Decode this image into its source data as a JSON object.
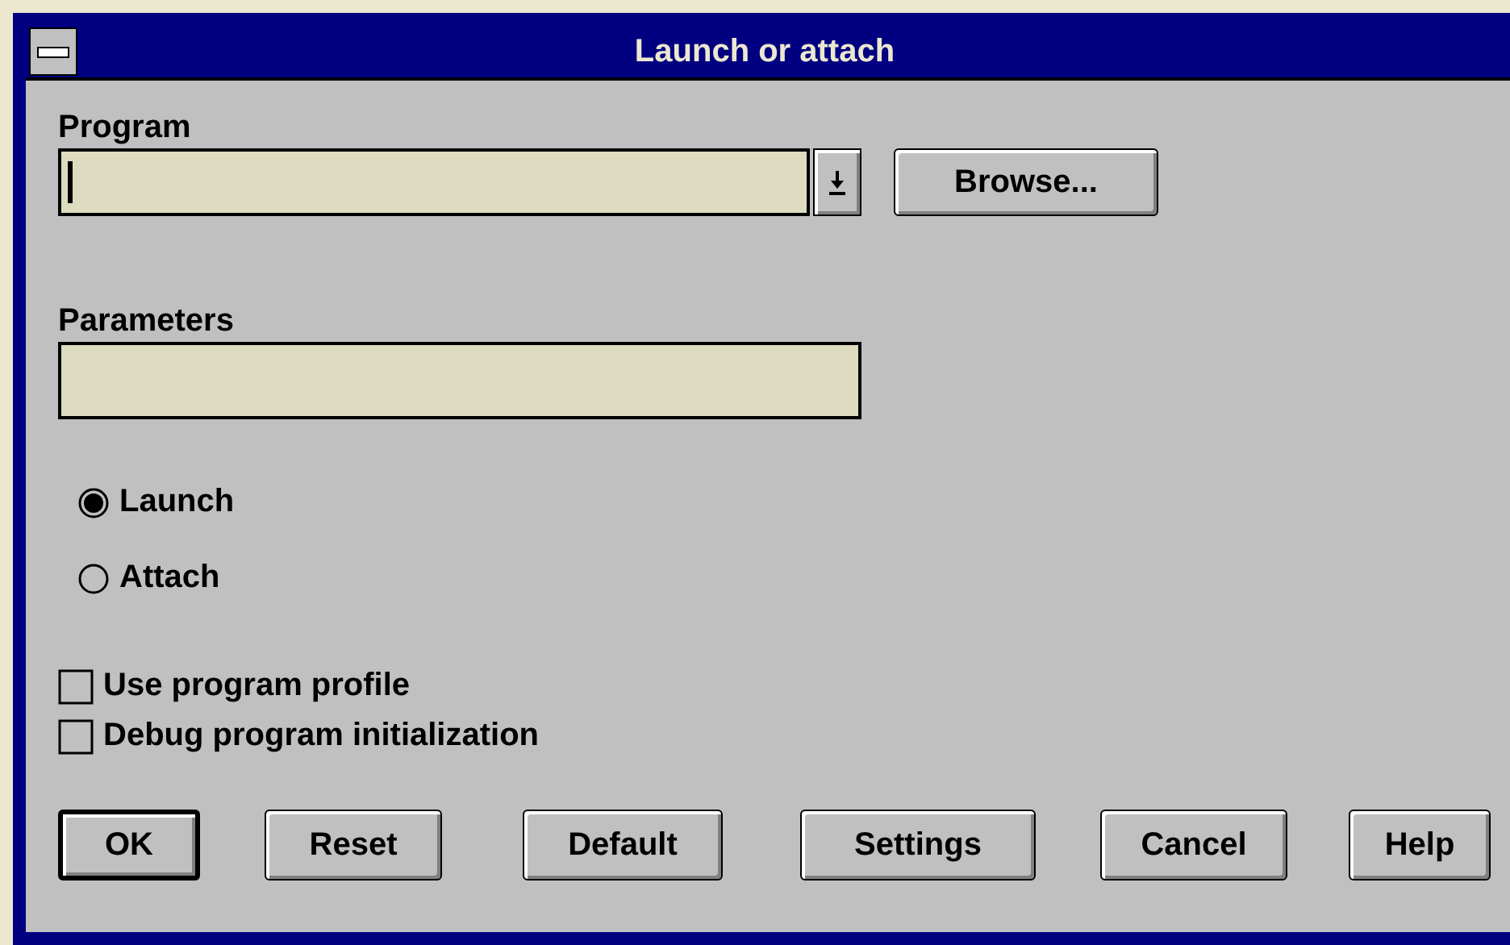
{
  "window": {
    "title": "Launch or attach"
  },
  "program": {
    "label": "Program",
    "focused": true
  },
  "browse_button": {
    "label": "Browse..."
  },
  "parameters": {
    "label": "Parameters"
  },
  "mode": [
    {
      "label": "Launch",
      "selected": true
    },
    {
      "label": "Attach",
      "selected": false
    }
  ],
  "options": [
    {
      "label": "Use program profile",
      "checked": false
    },
    {
      "label": "Debug program initialization",
      "checked": false
    }
  ],
  "buttons": [
    {
      "label": "OK",
      "default": true
    },
    {
      "label": "Reset",
      "default": false
    },
    {
      "label": "Default",
      "default": false
    },
    {
      "label": "Settings",
      "default": false
    },
    {
      "label": "Cancel",
      "default": false
    },
    {
      "label": "Help",
      "default": false
    }
  ]
}
